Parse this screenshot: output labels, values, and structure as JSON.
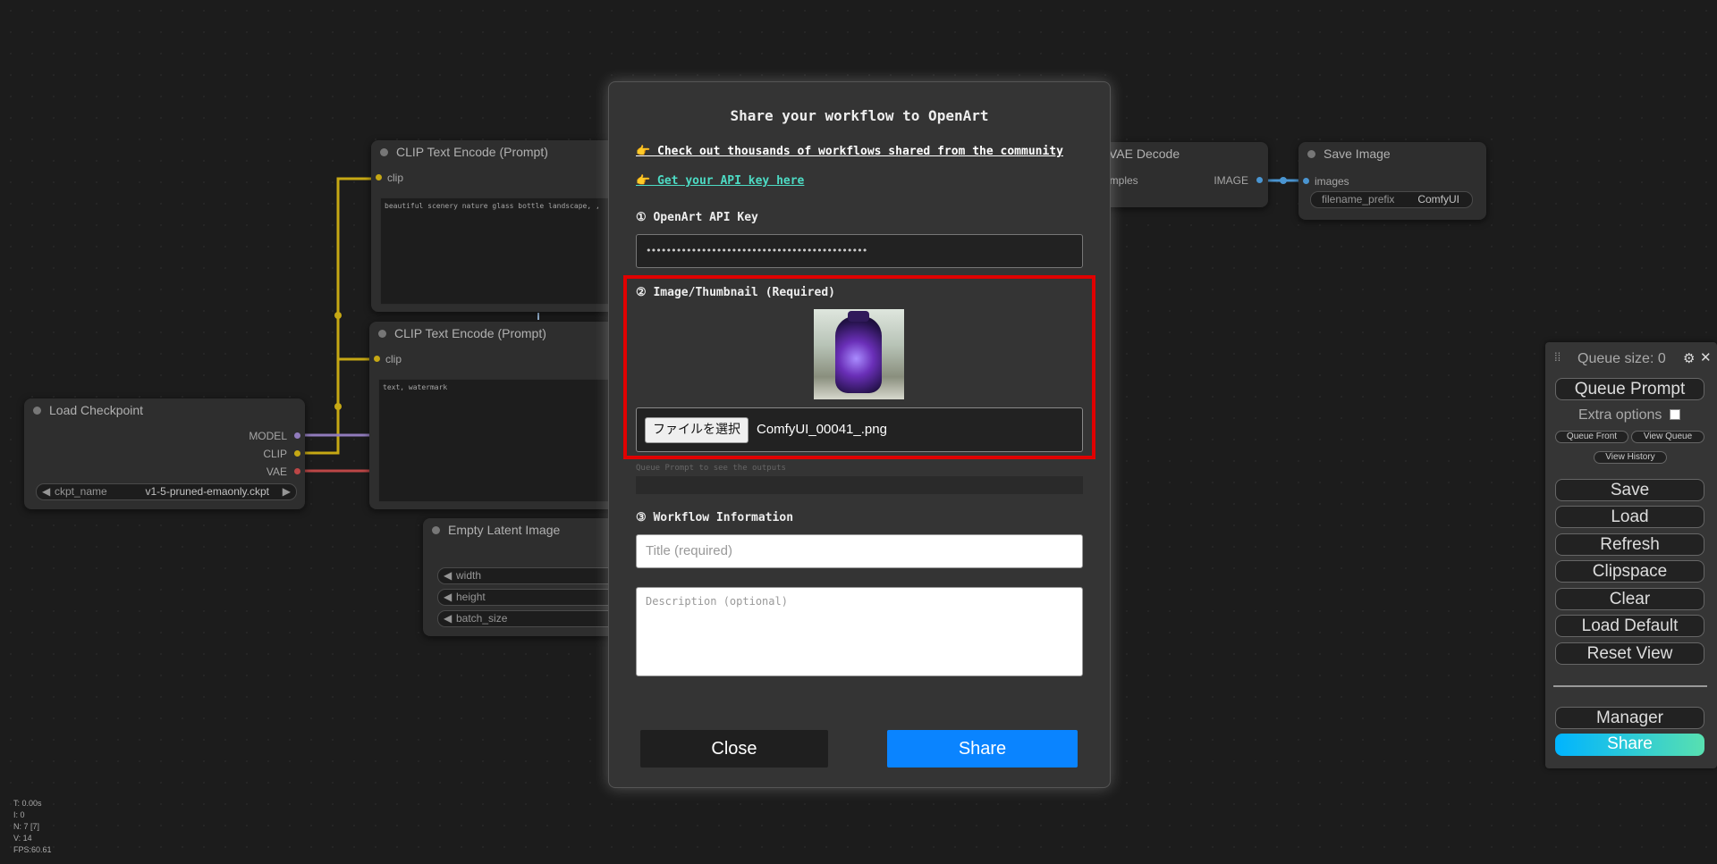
{
  "canvas": {
    "nodes": {
      "clip_top": {
        "title": "CLIP Text Encode (Prompt)",
        "input": "clip",
        "text": "beautiful scenery nature glass bottle landscape, ,"
      },
      "clip_bottom": {
        "title": "CLIP Text Encode (Prompt)",
        "input": "clip",
        "text": "text, watermark"
      },
      "load_checkpoint": {
        "title": "Load Checkpoint",
        "outputs": [
          "MODEL",
          "CLIP",
          "VAE"
        ],
        "widget_label": "ckpt_name",
        "widget_value": "v1-5-pruned-emaonly.ckpt"
      },
      "empty_latent": {
        "title": "Empty Latent Image",
        "widgets": [
          "width",
          "height",
          "batch_size"
        ]
      },
      "vae_decode": {
        "title": "VAE Decode",
        "input_partial": "amples",
        "input_partial2": "e",
        "output": "IMAGE"
      },
      "save_image": {
        "title": "Save Image",
        "input": "images",
        "widget_label": "filename_prefix",
        "widget_value": "ComfyUI"
      }
    },
    "hidden_text": "Queue Prompt to see the outputs",
    "stats": [
      "T: 0.00s",
      "I: 0",
      "N: 7 [7]",
      "V: 14",
      "FPS:60.61"
    ]
  },
  "modal": {
    "title": "Share your workflow to OpenArt",
    "link_community": "👉 Check out thousands of workflows shared from the community",
    "link_api_key": "👉 Get your API key here",
    "api_key_label": "① OpenArt API Key",
    "api_key_value": "••••••••••••••••••••••••••••••••••••••••••••",
    "image_label": "② Image/Thumbnail (Required)",
    "file_button": "ファイルを選択",
    "file_name": "ComfyUI_00041_.png",
    "workflow_label": "③ Workflow Information",
    "title_placeholder": "Title (required)",
    "description_placeholder": "Description (optional)",
    "close_label": "Close",
    "share_label": "Share",
    "highlight_color": "#e00000",
    "share_color": "#0a84ff"
  },
  "queue_panel": {
    "queue_size": "Queue size: 0",
    "queue_prompt": "Queue Prompt",
    "extra_options": "Extra options",
    "queue_front": "Queue Front",
    "view_queue": "View Queue",
    "view_history": "View History",
    "buttons": [
      "Save",
      "Load",
      "Refresh",
      "Clipspace",
      "Clear",
      "Load Default",
      "Reset View"
    ],
    "manager": "Manager",
    "share": "Share"
  }
}
